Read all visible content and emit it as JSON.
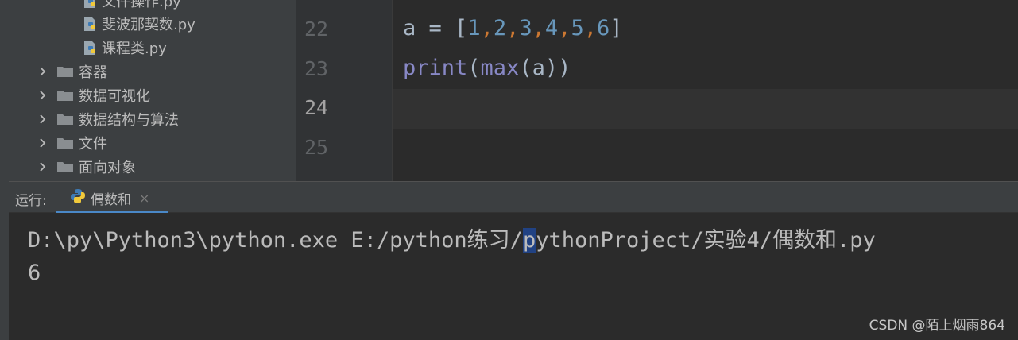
{
  "project_tree": {
    "files": [
      {
        "label": "文件操作.py",
        "icon": "python-file-icon"
      },
      {
        "label": "斐波那契数.py",
        "icon": "python-file-icon"
      },
      {
        "label": "课程类.py",
        "icon": "python-file-icon"
      }
    ],
    "folders": [
      {
        "label": "容器"
      },
      {
        "label": "数据可视化"
      },
      {
        "label": "数据结构与算法"
      },
      {
        "label": "文件"
      },
      {
        "label": "面向对象"
      }
    ]
  },
  "editor": {
    "line_numbers": [
      "22",
      "23",
      "24",
      "25"
    ],
    "current_line": "24",
    "code": {
      "line22": {
        "var": "a",
        "op": " = ",
        "open": "[",
        "nums": [
          "1",
          "2",
          "3",
          "4",
          "5",
          "6"
        ],
        "comma": ",",
        "close": "]"
      },
      "line23": {
        "func1": "print",
        "p1": "(",
        "func2": "max",
        "p2": "(",
        "arg": "a",
        "p3": "))"
      }
    }
  },
  "run_panel": {
    "label": "运行:",
    "tab_label": "偶数和",
    "close_glyph": "×"
  },
  "console": {
    "line1_before": "D:\\py\\Python3\\python.exe E:/python练习/",
    "line1_caret": "p",
    "line1_after": "ythonProject/实验4/偶数和.py",
    "line2": "6"
  },
  "watermark": "CSDN @陌上烟雨864",
  "colors": {
    "keyword_number": "#6897bb",
    "builtin": "#8888c6",
    "comma": "#cc7832",
    "tab_underline": "#4a88c7"
  }
}
